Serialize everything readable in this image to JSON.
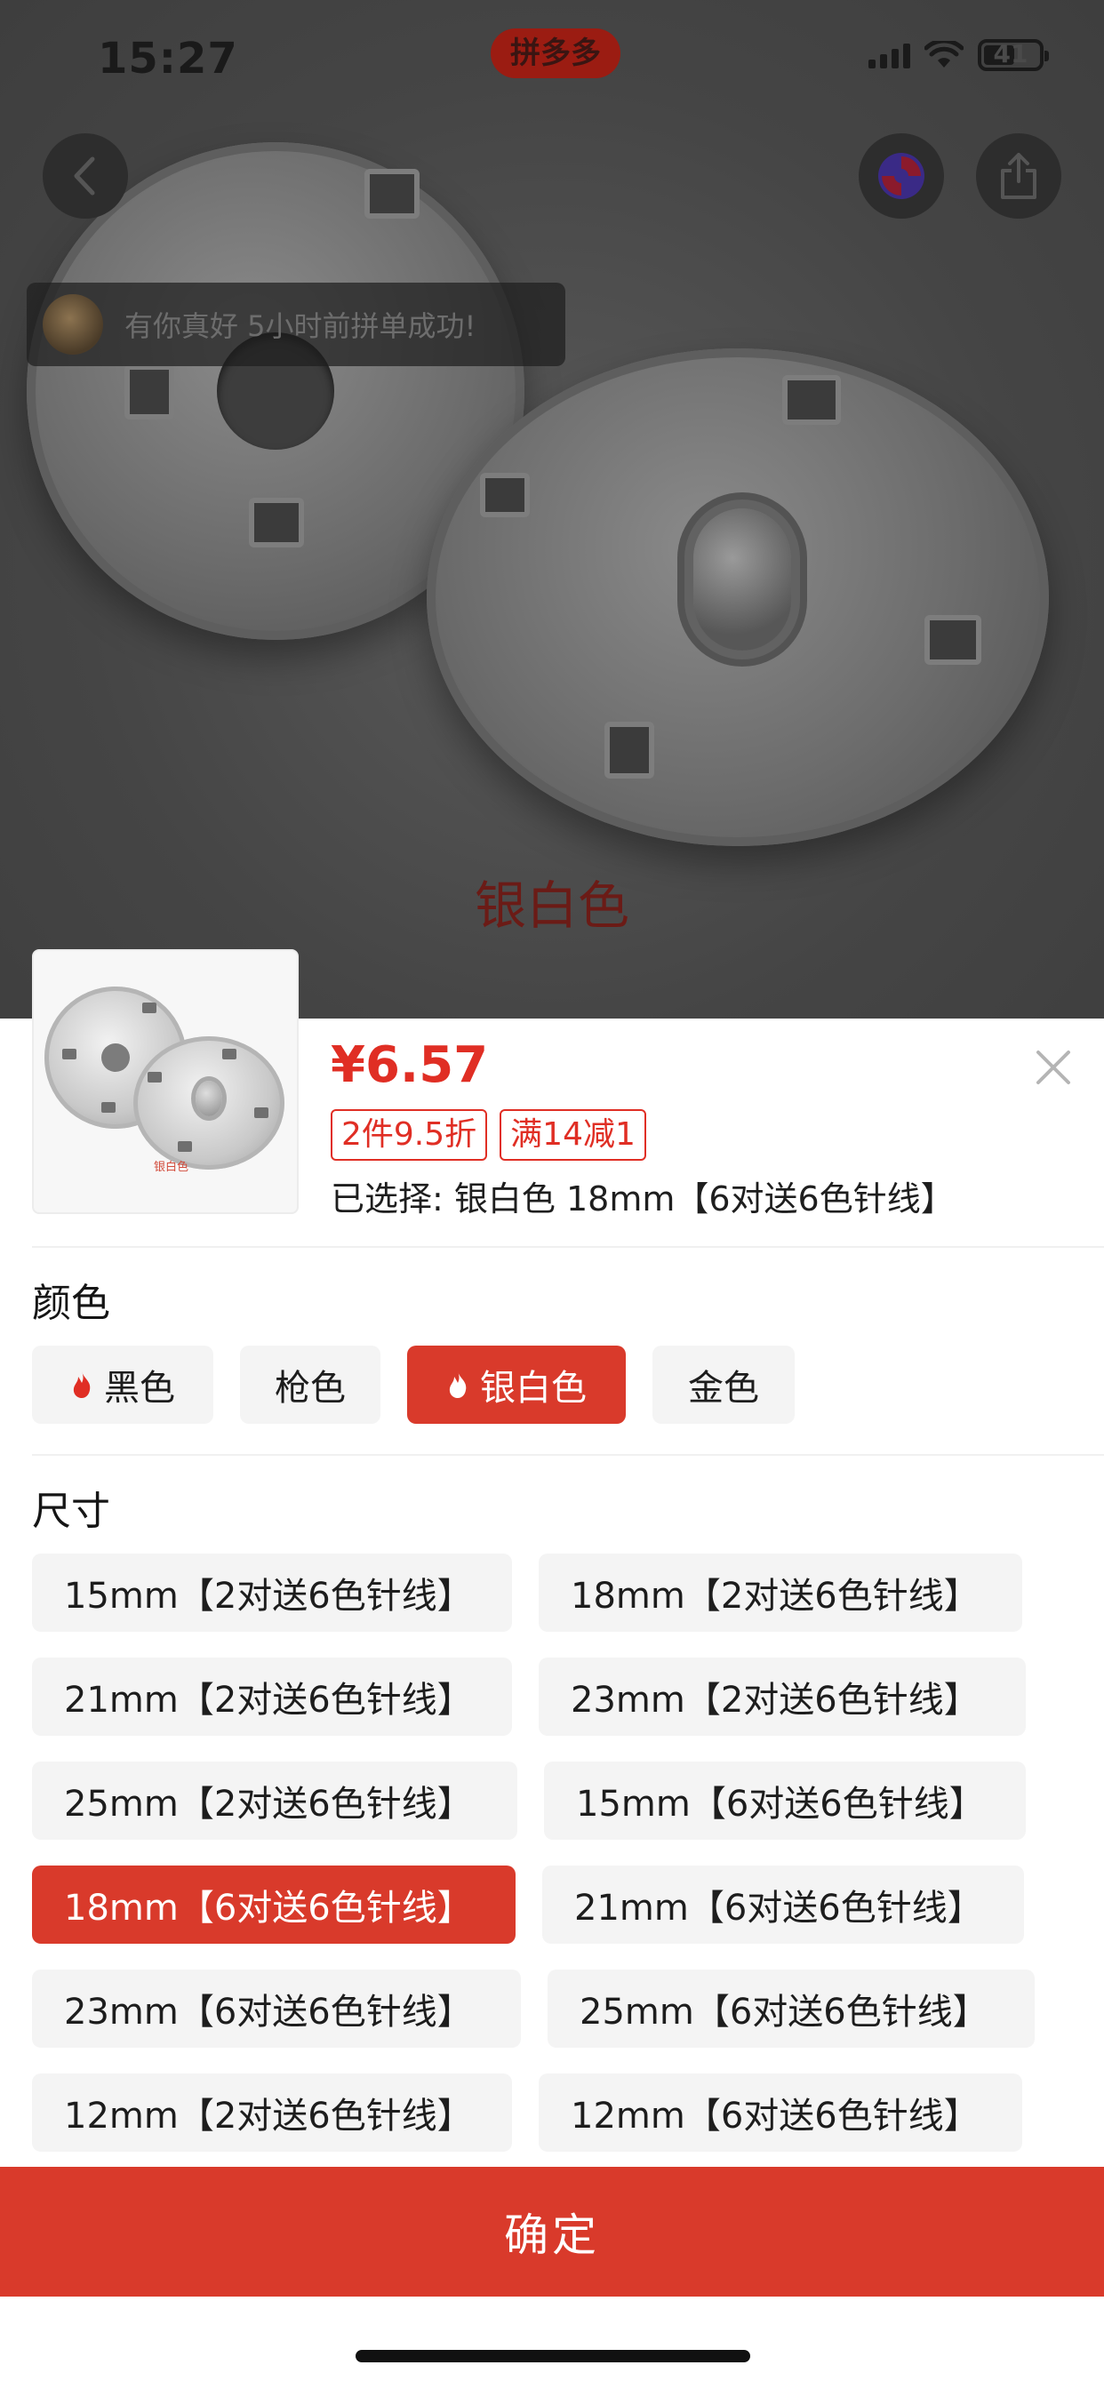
{
  "status_bar": {
    "time": "15:27",
    "battery": "41",
    "center_badge": "拼多多"
  },
  "product_view": {
    "group_notice": "有你真好 5小时前拼单成功!",
    "variant_caption": "银白色",
    "thumbnail_caption": "银白色"
  },
  "sheet": {
    "price": "¥6.57",
    "promos": [
      "2件9.5折",
      "满14减1"
    ],
    "selected_info": "已选择: 银白色 18mm【6对送6色针线】"
  },
  "color_section": {
    "title": "颜色",
    "options": [
      {
        "label": "黑色",
        "hot": true,
        "selected": false
      },
      {
        "label": "枪色",
        "hot": false,
        "selected": false
      },
      {
        "label": "银白色",
        "hot": true,
        "selected": true
      },
      {
        "label": "金色",
        "hot": false,
        "selected": false
      }
    ]
  },
  "size_section": {
    "title": "尺寸",
    "options": [
      {
        "label": "15mm【2对送6色针线】",
        "selected": false
      },
      {
        "label": "18mm【2对送6色针线】",
        "selected": false
      },
      {
        "label": "21mm【2对送6色针线】",
        "selected": false
      },
      {
        "label": "23mm【2对送6色针线】",
        "selected": false
      },
      {
        "label": "25mm【2对送6色针线】",
        "selected": false
      },
      {
        "label": "15mm【6对送6色针线】",
        "selected": false
      },
      {
        "label": "18mm【6对送6色针线】",
        "selected": true
      },
      {
        "label": "21mm【6对送6色针线】",
        "selected": false
      },
      {
        "label": "23mm【6对送6色针线】",
        "selected": false
      },
      {
        "label": "25mm【6对送6色针线】",
        "selected": false
      },
      {
        "label": "12mm【2对送6色针线】",
        "selected": false
      },
      {
        "label": "12mm【6对送6色针线】",
        "selected": false
      }
    ]
  },
  "confirm_label": "确定",
  "colors": {
    "accent": "#e02e24",
    "selected_bg": "#d93a2b",
    "option_bg": "#f4f4f4"
  }
}
